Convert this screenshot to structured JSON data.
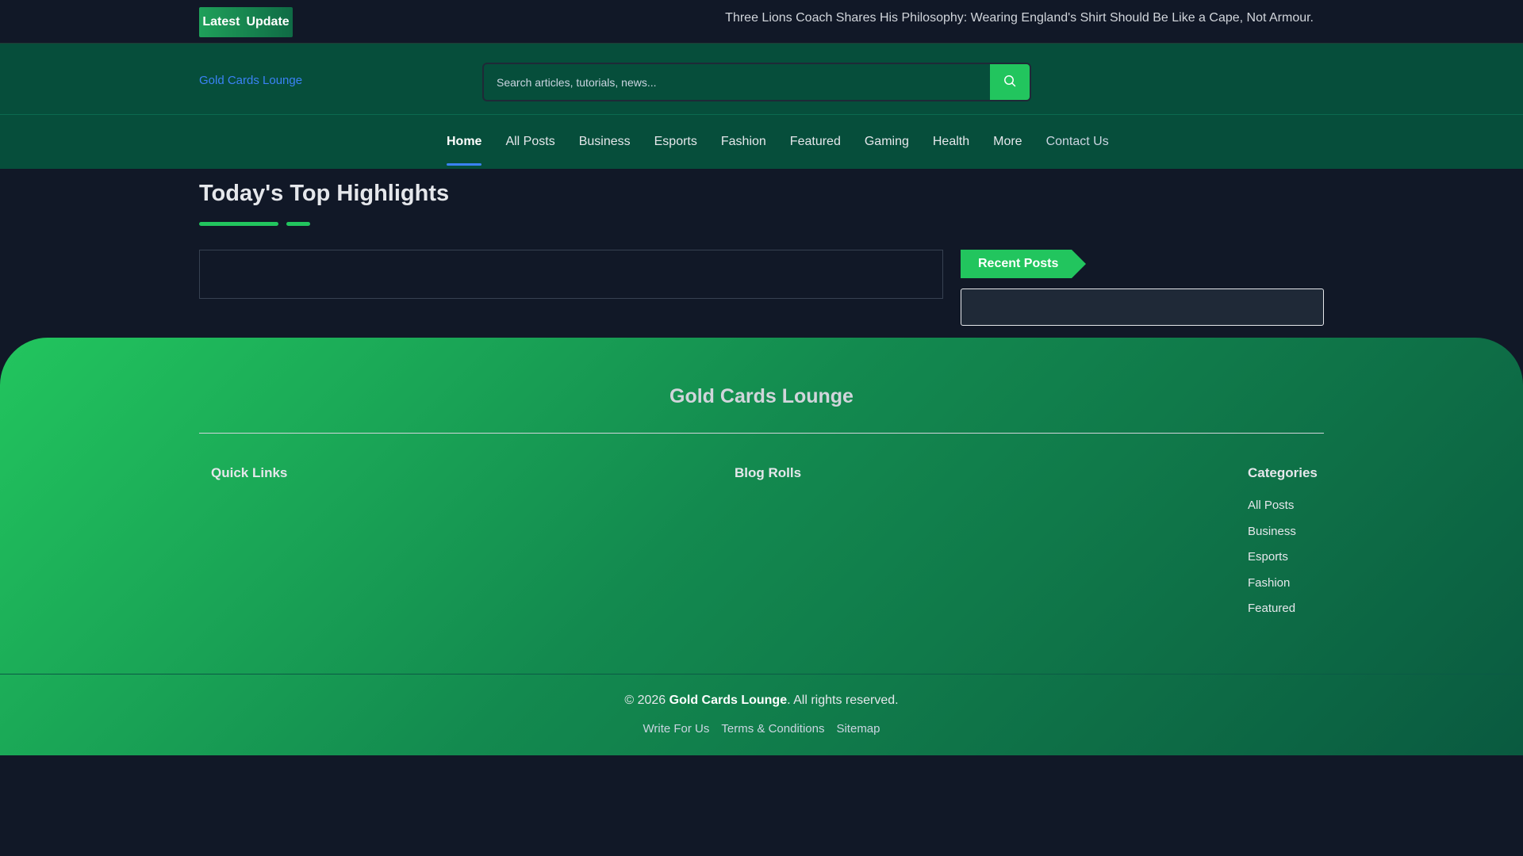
{
  "topbar": {
    "badge_label_1": "Latest",
    "badge_label_2": "Update",
    "ticker": "Three Lions Coach Shares His Philosophy: Wearing England's Shirt Should Be Like a Cape, Not Armour."
  },
  "header": {
    "logo_text": "Gold Cards Lounge",
    "search_placeholder": "Search articles, tutorials, news...",
    "search_icon": "search-icon"
  },
  "nav": {
    "items": [
      {
        "label": "Home",
        "active": true
      },
      {
        "label": "All Posts"
      },
      {
        "label": "Business"
      },
      {
        "label": "Esports"
      },
      {
        "label": "Fashion"
      },
      {
        "label": "Featured"
      },
      {
        "label": "Gaming"
      },
      {
        "label": "Health"
      },
      {
        "label": "More"
      },
      {
        "label": "Contact Us"
      }
    ]
  },
  "main": {
    "section_title": "Today's Top Highlights",
    "recent_posts_label": "Recent Posts"
  },
  "footer": {
    "brand": "Gold Cards Lounge",
    "quick_links_heading": "Quick Links",
    "blog_rolls_heading": "Blog Rolls",
    "categories_heading": "Categories",
    "categories": [
      "All Posts",
      "Business",
      "Esports",
      "Fashion",
      "Featured"
    ],
    "copyright_prefix": "© 2026 ",
    "copyright_brand": "Gold Cards Lounge",
    "copyright_suffix": ". All rights reserved.",
    "bottom_links": [
      "Write For Us",
      "Terms & Conditions",
      "Sitemap"
    ]
  },
  "colors": {
    "background": "#111827",
    "header_green": "#064e3b",
    "accent_green": "#22c55e",
    "link_blue": "#3b82f6"
  }
}
